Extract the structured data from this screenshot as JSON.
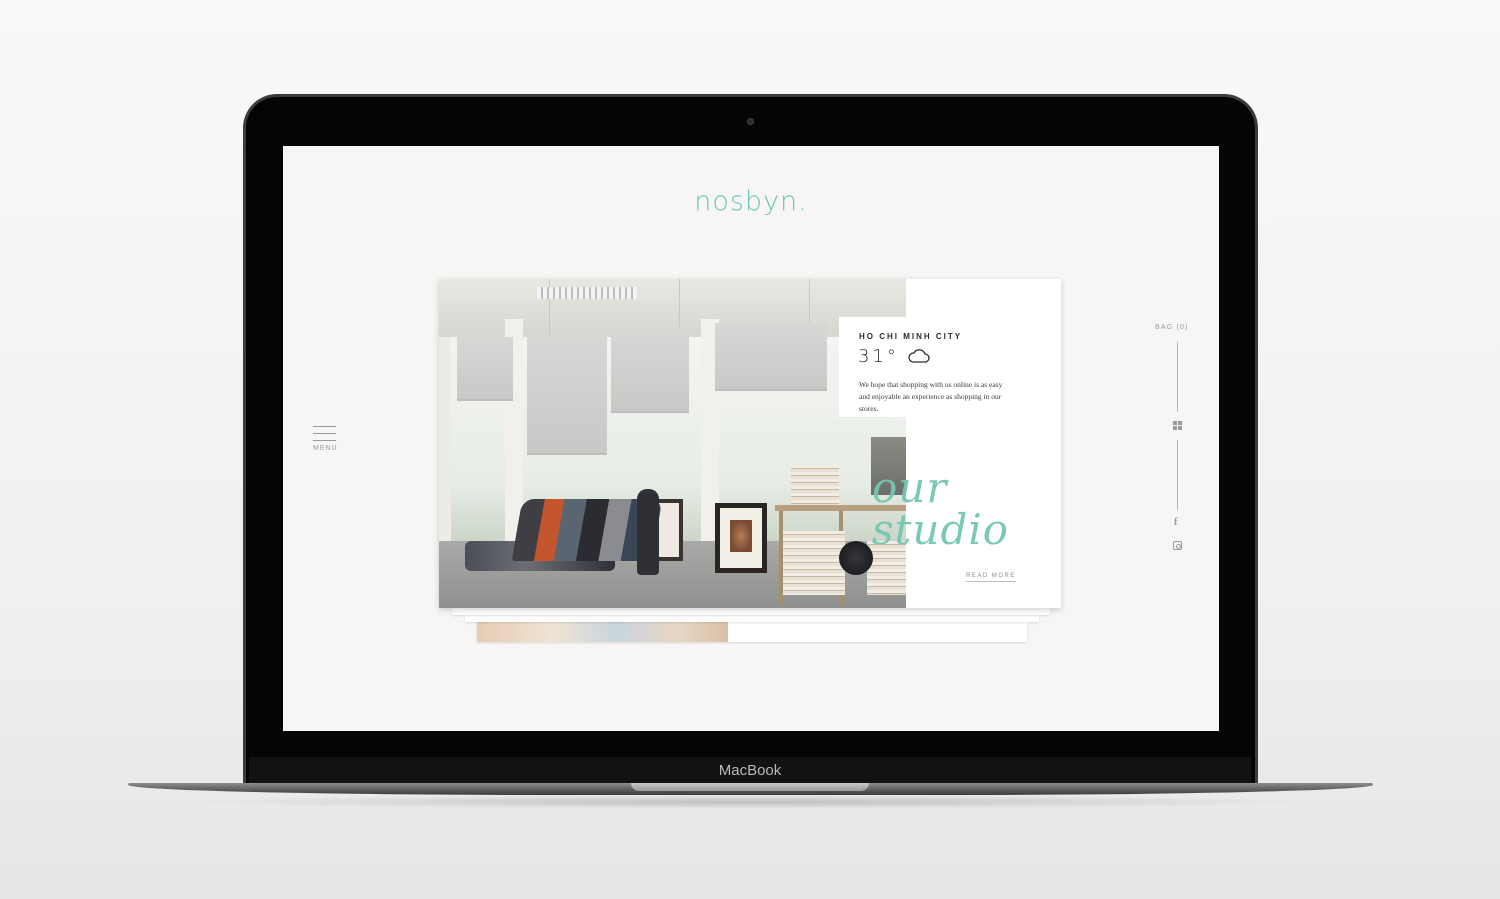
{
  "site": {
    "logo": "nosbyn."
  },
  "nav": {
    "menu_label": "MENU",
    "bag_label": "BAG (0)"
  },
  "feature": {
    "city": "HO CHI MINH CITY",
    "temperature": "31°",
    "weather_icon": "cloud-icon",
    "description": "We hope that shopping with us online is as easy and enjoyable an experience as shopping in our stores.",
    "headline_line1": "our",
    "headline_line2": "studio",
    "cta": "READ MORE"
  },
  "social": {
    "facebook_icon": "f",
    "instagram_icon": "instagram-icon"
  },
  "device": {
    "label": "MacBook"
  },
  "colors": {
    "accent": "#6cc7b1",
    "background": "#f7f6f4",
    "text": "#2d2d2d"
  }
}
